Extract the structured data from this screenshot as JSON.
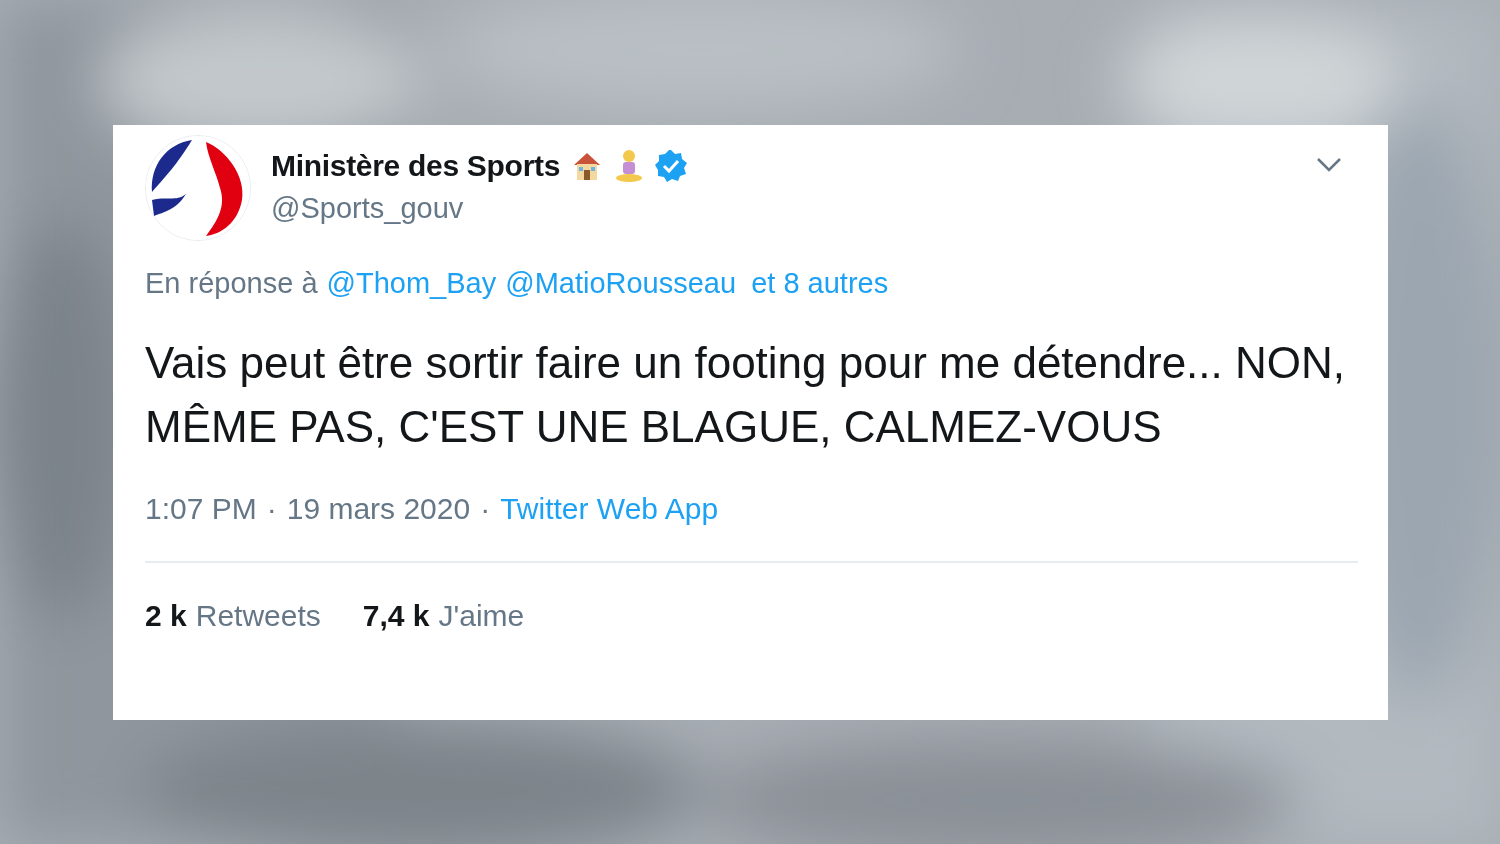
{
  "author": {
    "name": "Ministère des Sports",
    "handle": "@Sports_gouv",
    "verified": true
  },
  "reply": {
    "prefix": "En réponse à",
    "mentions": [
      "@Thom_Bay",
      "@MatioRousseau"
    ],
    "others": "et 8 autres"
  },
  "text": "Vais peut être sortir faire un footing pour me détendre... NON, MÊME PAS, C'EST UNE BLAGUE, CALMEZ-VOUS",
  "meta": {
    "time": "1:07 PM",
    "separator": "·",
    "date": "19 mars 2020",
    "source_separator": "·",
    "source": "Twitter Web App"
  },
  "stats": [
    {
      "count": "2 k",
      "label": "Retweets"
    },
    {
      "count": "7,4 k",
      "label": "J'aime"
    }
  ]
}
